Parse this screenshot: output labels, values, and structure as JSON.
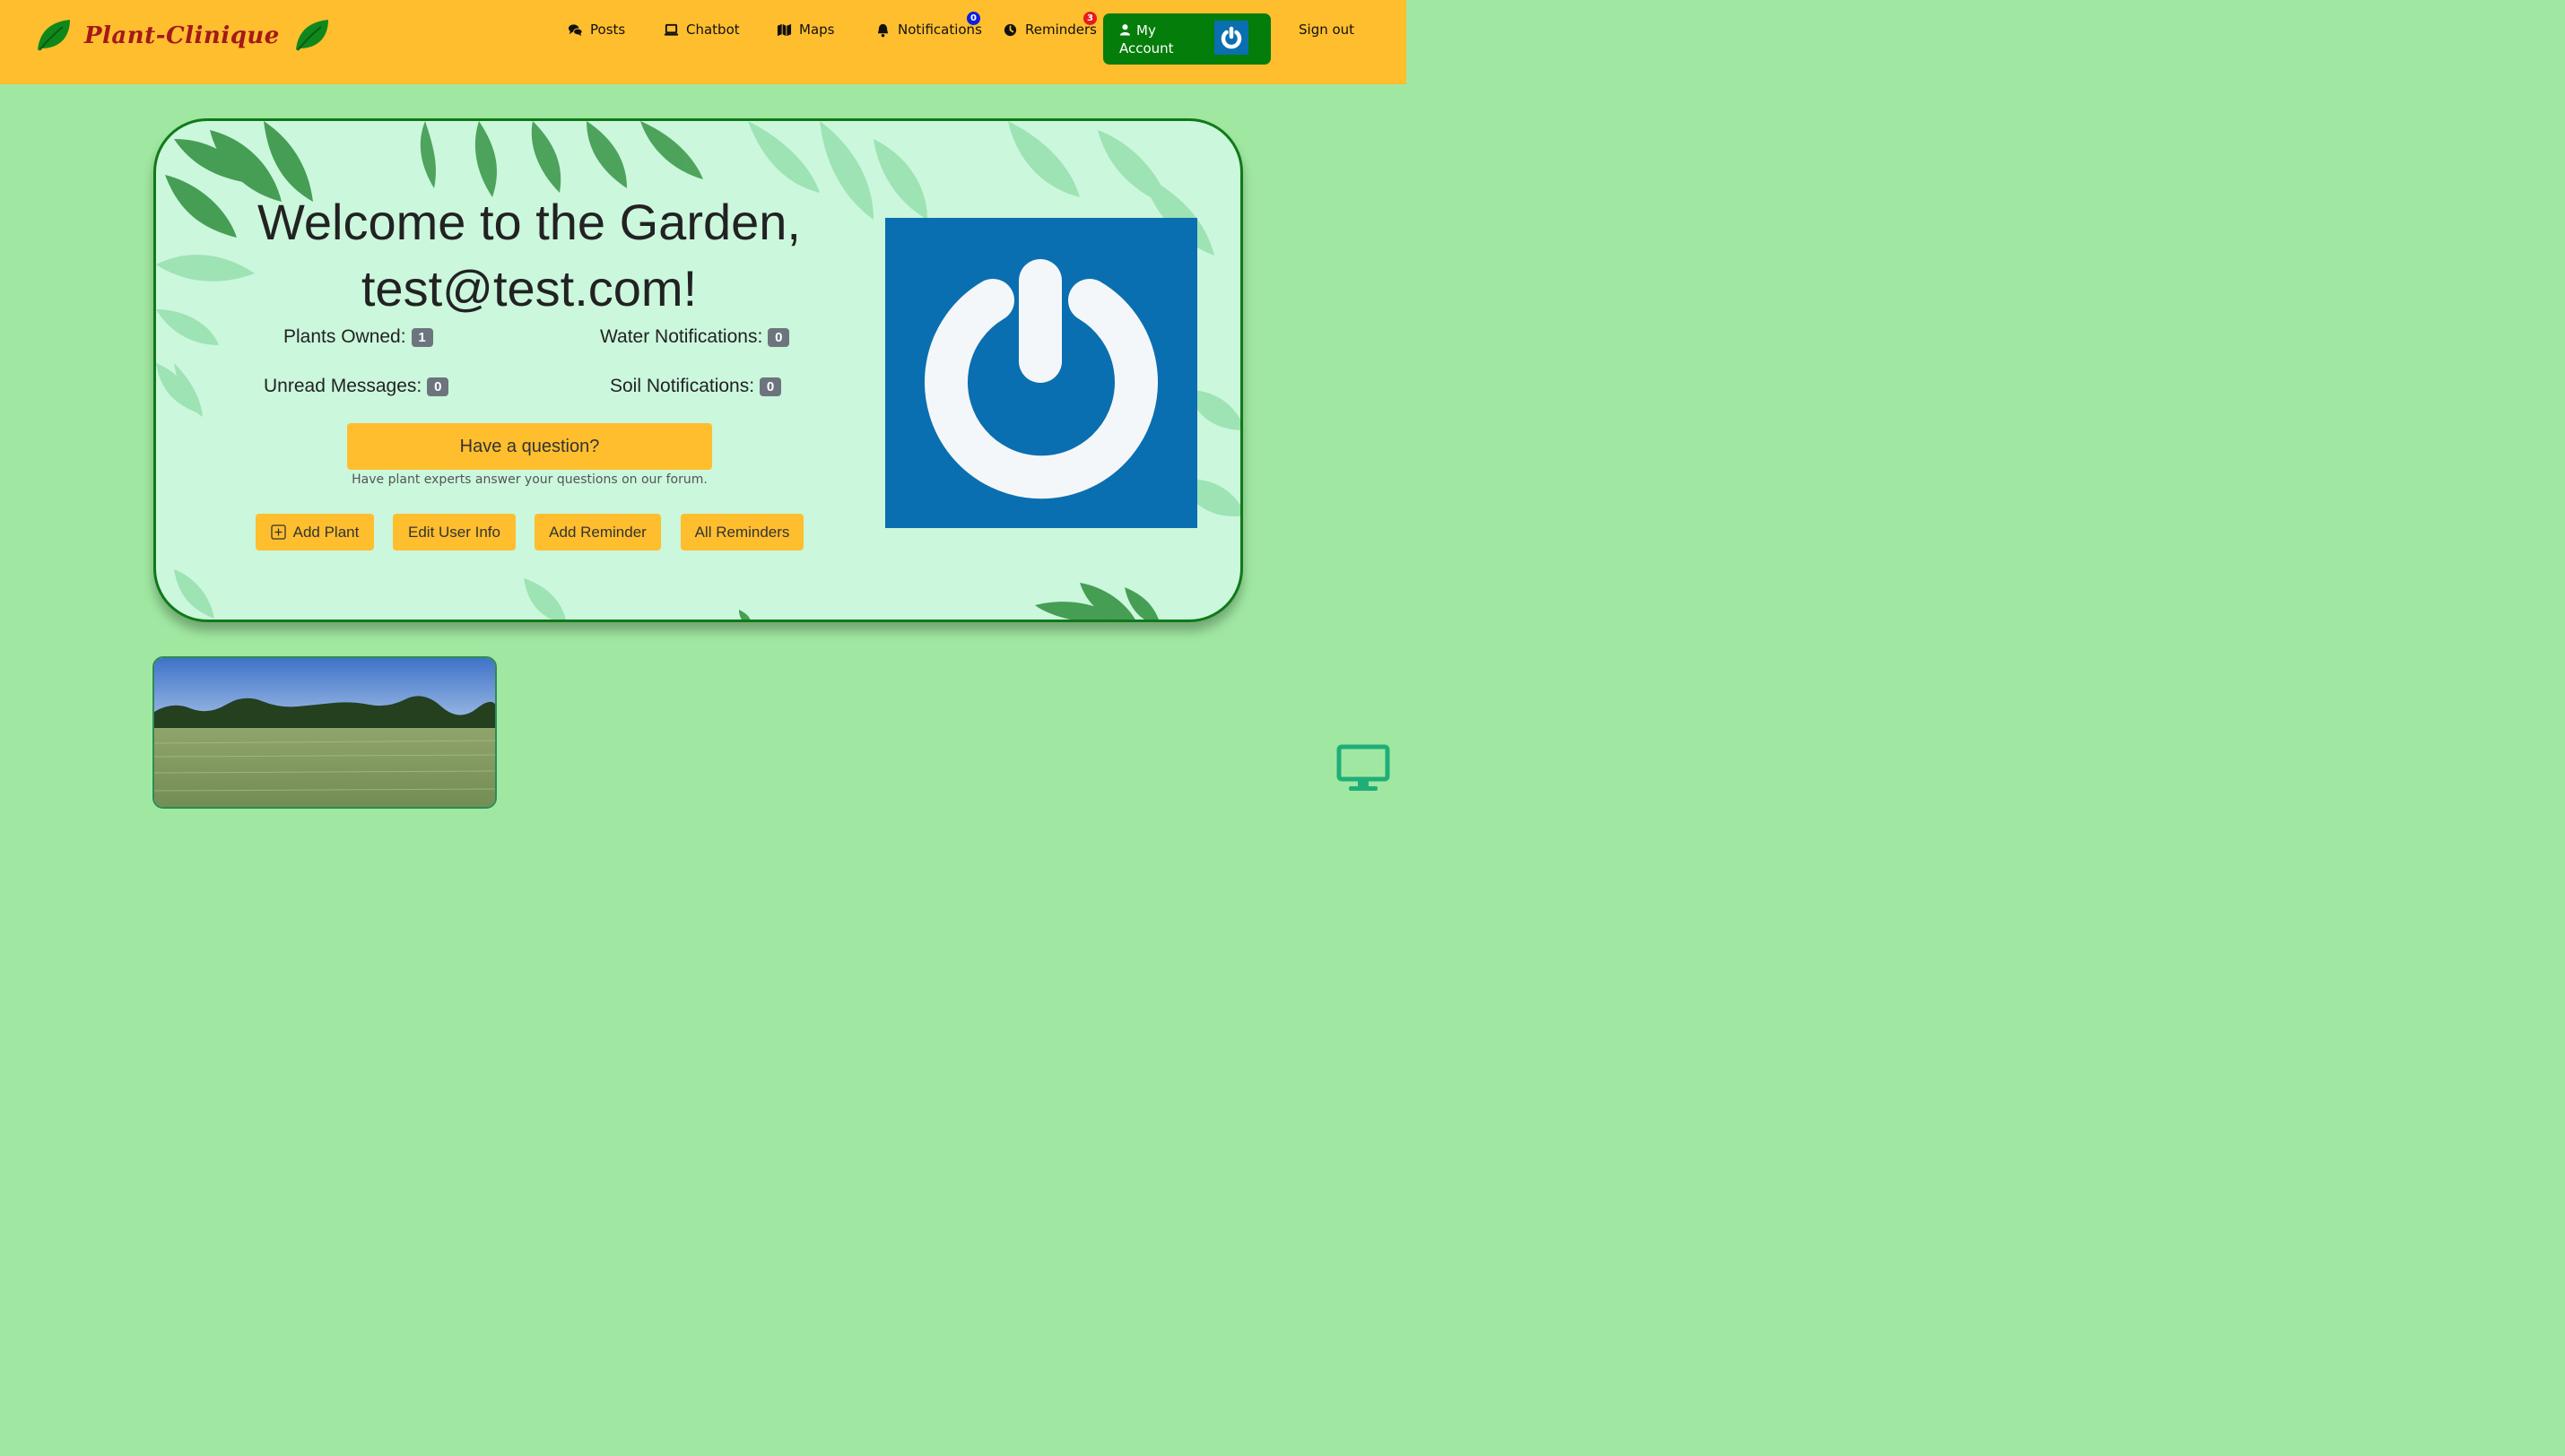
{
  "brand": {
    "name": "Plant-Clinique",
    "leaf_icon": "leaf-icon"
  },
  "nav": {
    "posts": "Posts",
    "chatbot": "Chatbot",
    "maps": "Maps",
    "notifications": "Notifications",
    "notifications_count": "0",
    "reminders": "Reminders",
    "reminders_count": "3",
    "account_label": "My Account",
    "sign_out": "Sign out"
  },
  "welcome": {
    "line1": "Welcome to the Garden,",
    "line2": "test@test.com!",
    "stats": {
      "plants_owned_label": "Plants Owned:",
      "plants_owned": "1",
      "water_label": "Water Notifications:",
      "water": "0",
      "unread_label": "Unread Messages:",
      "unread": "0",
      "soil_label": "Soil Notifications:",
      "soil": "0"
    },
    "question_button": "Have a question?",
    "question_help": "Have plant experts answer your questions on our forum.",
    "actions": {
      "add_plant": "Add Plant",
      "edit_user": "Edit User Info",
      "add_reminder": "Add Reminder",
      "all_reminders": "All Reminders"
    }
  },
  "colors": {
    "page_bg": "#a0e8a1",
    "navbar_bg": "#ffbe2e",
    "brand_text": "#a3191b",
    "account_bg": "#047d0b",
    "card_bg": "#cbf7dd",
    "card_border": "#0f7a17",
    "badge_blue": "#0d1fe0",
    "badge_red": "#e81c1c",
    "stat_badge": "#6c757d",
    "avatar_blue": "#0a6fb0"
  }
}
